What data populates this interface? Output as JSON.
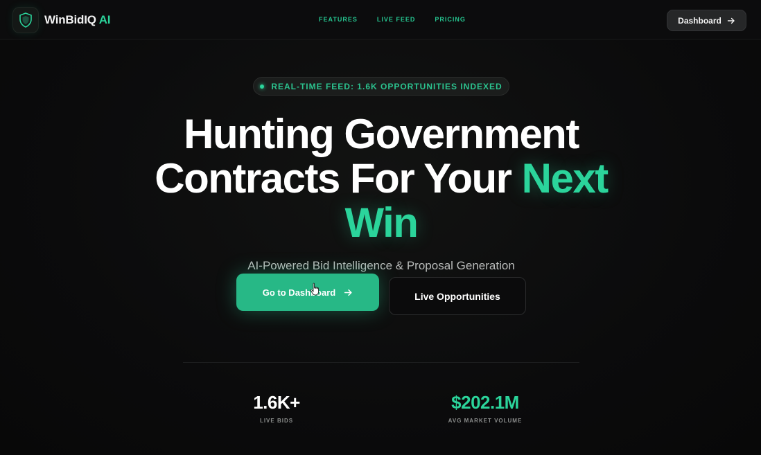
{
  "header": {
    "brand_name": "WinBidIQ",
    "brand_suffix": "AI",
    "nav": [
      "FEATURES",
      "LIVE FEED",
      "PRICING"
    ],
    "dashboard_label": "Dashboard"
  },
  "hero": {
    "badge": "REAL-TIME FEED: 1.6K OPPORTUNITIES INDEXED",
    "headline_line1": "Hunting Government",
    "headline_line2_white": "Contracts For Your",
    "headline_line2_accent": "Next",
    "headline_line3_accent": "Win",
    "subtitle": "AI-Powered Bid Intelligence & Proposal Generation",
    "cta_primary": "Go to Dashboard",
    "cta_secondary": "Live Opportunities"
  },
  "stats": [
    {
      "value": "1.6K+",
      "label": "LIVE BIDS"
    },
    {
      "value": "$202.1M",
      "label": "AVG MARKET VOLUME"
    }
  ],
  "colors": {
    "accent": "#2bd49b",
    "background": "#0b0b0c",
    "button_primary": "#27b886"
  },
  "icons": [
    "shield-icon",
    "arrow-right-icon",
    "pointer-cursor-icon"
  ]
}
